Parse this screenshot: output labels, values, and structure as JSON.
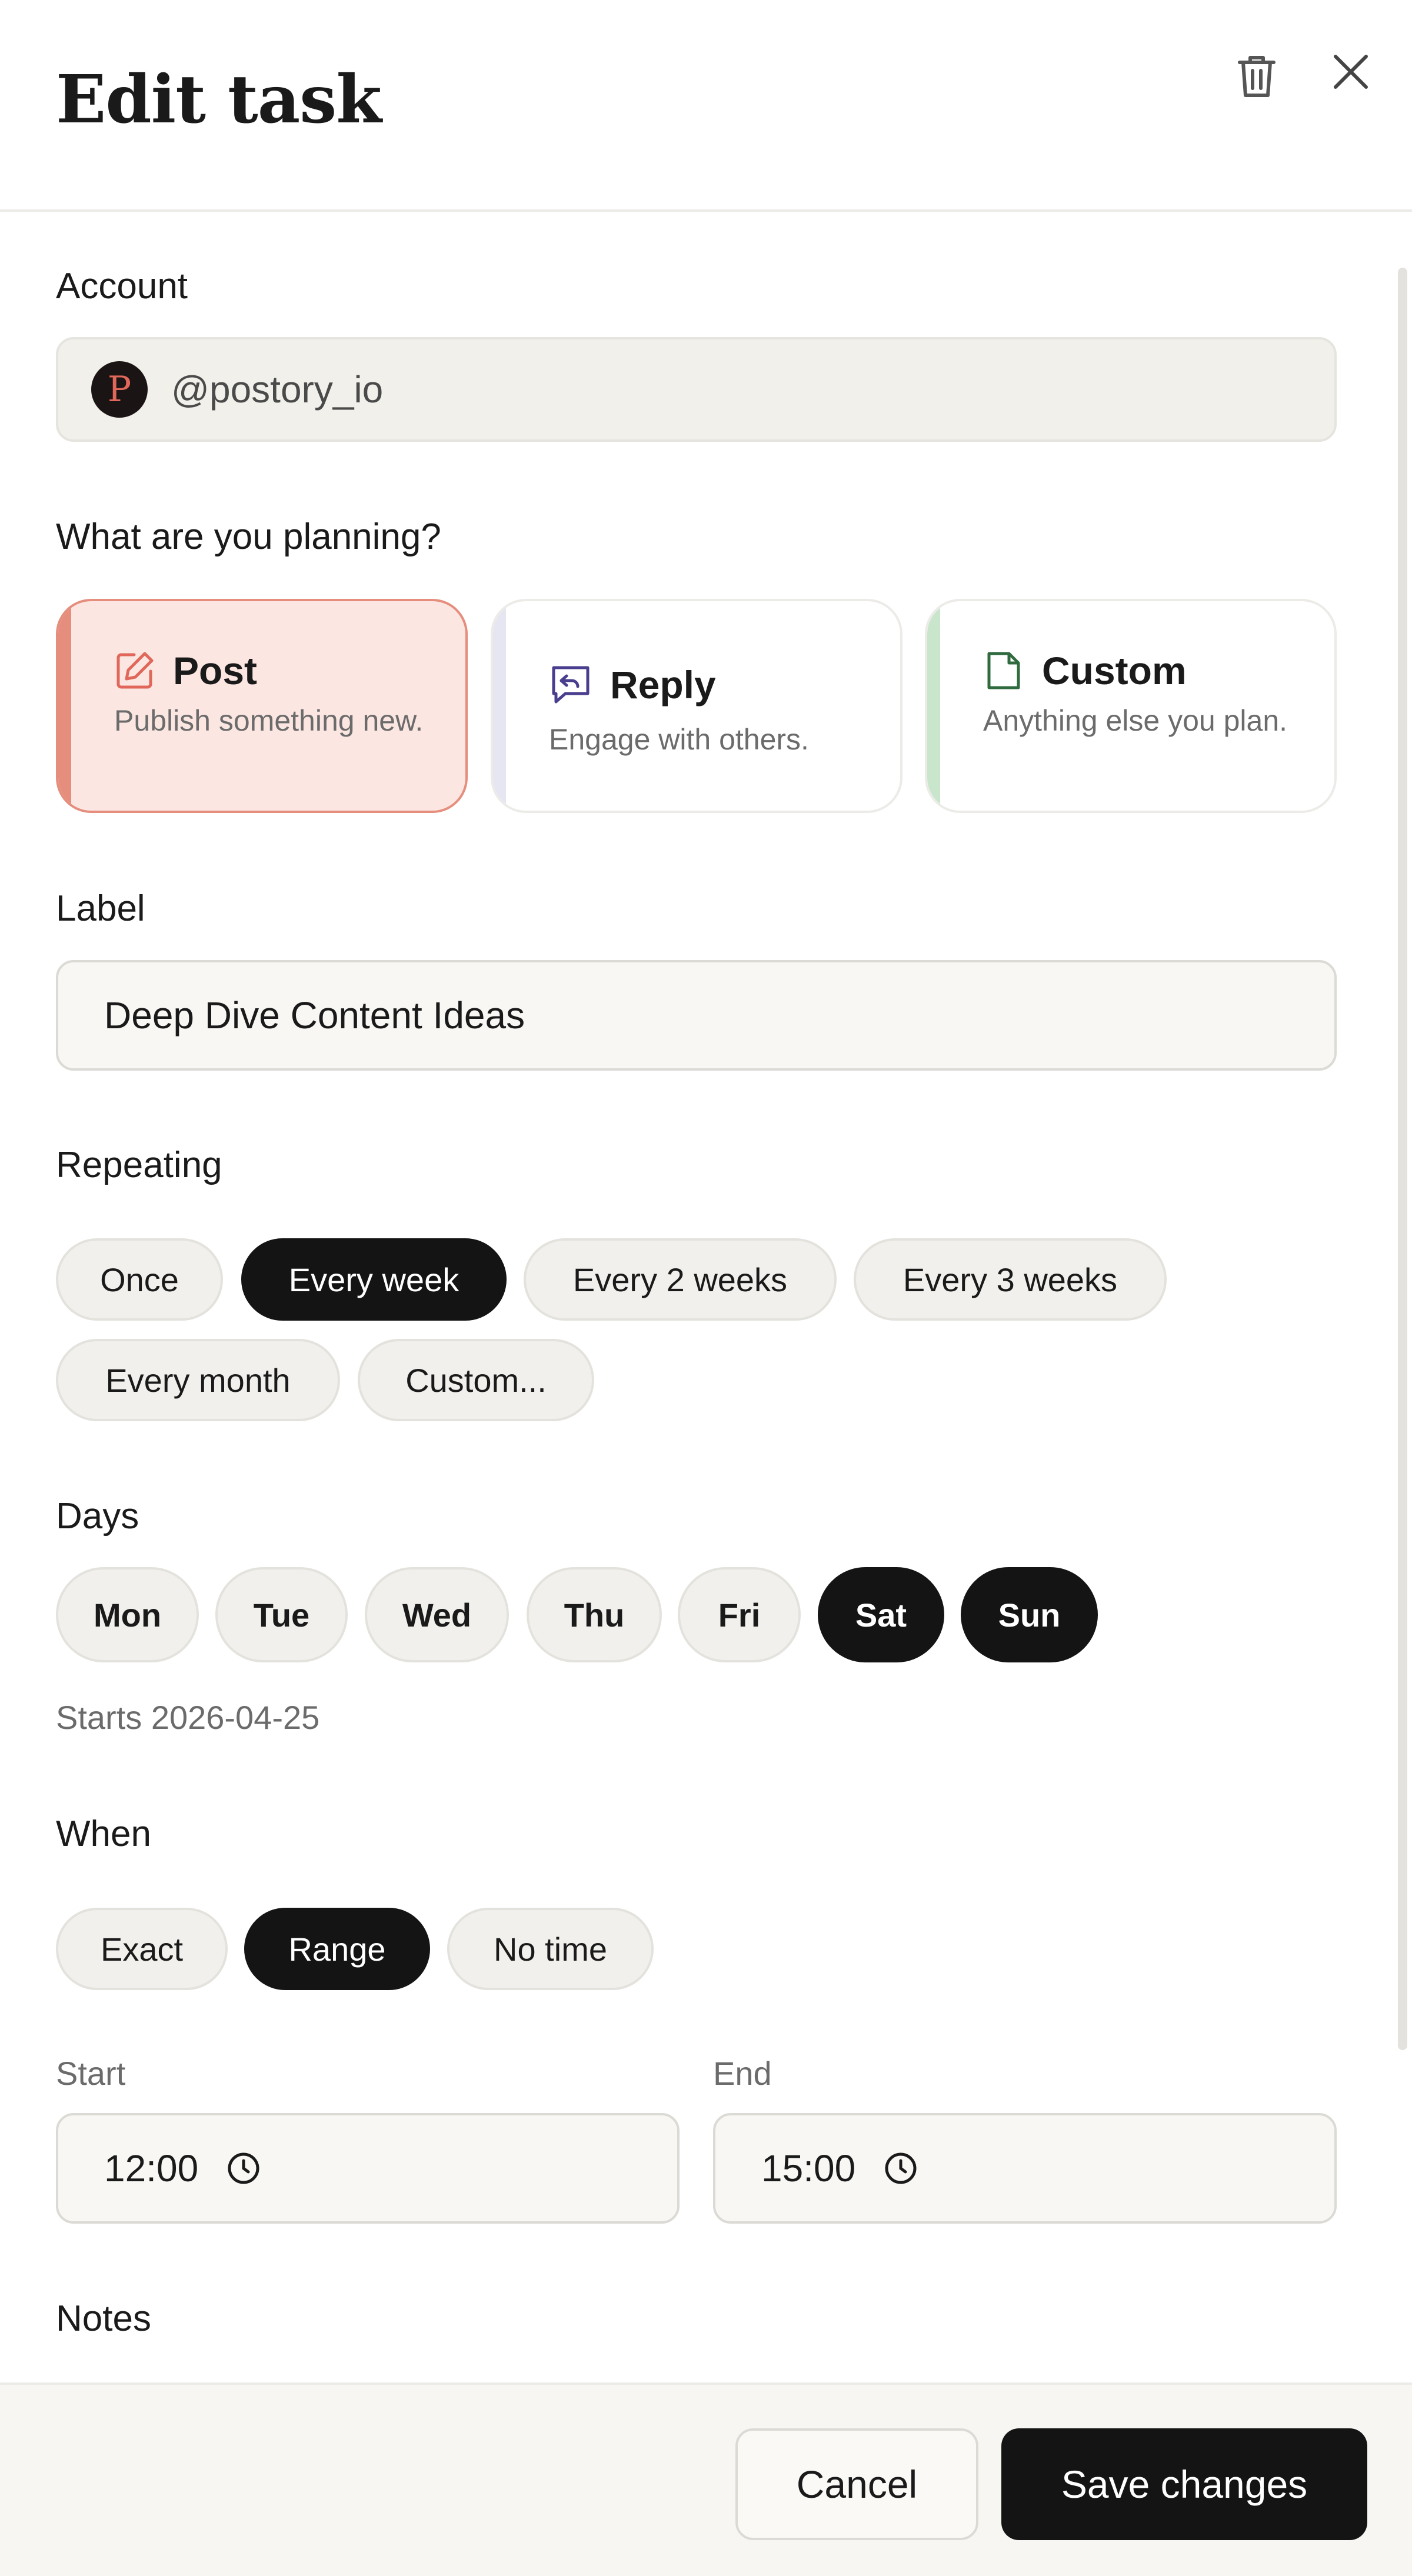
{
  "header": {
    "title": "Edit task"
  },
  "account": {
    "label": "Account",
    "value": "@postory_io",
    "avatar_letter": "P"
  },
  "planning": {
    "label": "What are you planning?",
    "options": [
      {
        "title": "Post",
        "desc": "Publish something new.",
        "icon": "edit-icon",
        "strip_color": "#e58e7d",
        "selected": true
      },
      {
        "title": "Reply",
        "desc": "Engage with others.",
        "icon": "reply-icon",
        "strip_color": "#e6e5f2",
        "selected": false
      },
      {
        "title": "Custom",
        "desc": "Anything else you plan.",
        "icon": "document-icon",
        "strip_color": "#c9e6cc",
        "selected": false
      }
    ]
  },
  "label_field": {
    "label": "Label",
    "value": "Deep Dive Content Ideas"
  },
  "repeating": {
    "label": "Repeating",
    "options": [
      "Once",
      "Every week",
      "Every 2 weeks",
      "Every 3 weeks",
      "Every month",
      "Custom..."
    ],
    "selected": "Every week"
  },
  "days": {
    "label": "Days",
    "options": [
      "Mon",
      "Tue",
      "Wed",
      "Thu",
      "Fri",
      "Sat",
      "Sun"
    ],
    "selected": [
      "Sat",
      "Sun"
    ],
    "starts": "Starts 2026-04-25"
  },
  "when": {
    "label": "When",
    "options": [
      "Exact",
      "Range",
      "No time"
    ],
    "selected": "Range",
    "start_label": "Start",
    "start_value": "12:00",
    "end_label": "End",
    "end_value": "15:00"
  },
  "notes": {
    "label": "Notes"
  },
  "footer": {
    "cancel": "Cancel",
    "save": "Save changes"
  },
  "colors": {
    "accent_post": "#e58e7d",
    "reply_icon": "#4a3f8f",
    "custom_icon": "#2f6b3e",
    "dark": "#141414"
  }
}
